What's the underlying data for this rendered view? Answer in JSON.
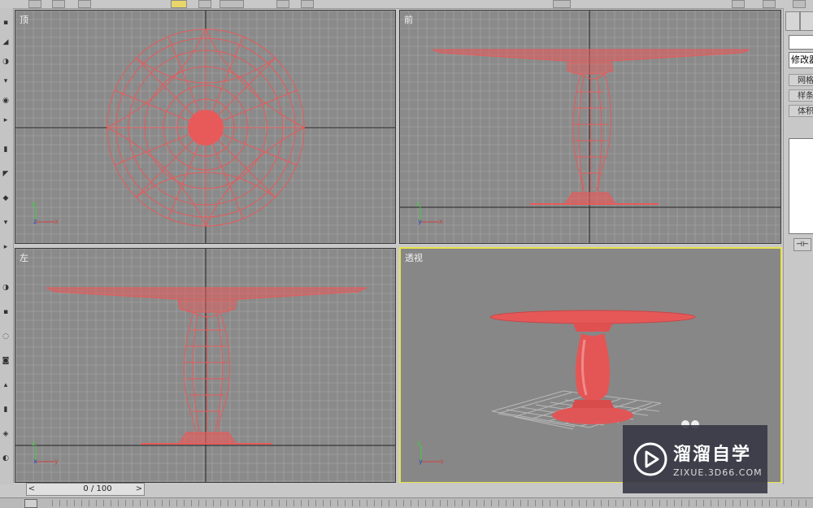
{
  "viewports": {
    "top": {
      "label": "顶"
    },
    "front": {
      "label": "前"
    },
    "left": {
      "label": "左"
    },
    "perspective": {
      "label": "透视"
    }
  },
  "command_panel": {
    "modifier_list": "修改器列表",
    "buttons": [
      "网格",
      "样条",
      "体积"
    ],
    "small_button": "⊣⊢"
  },
  "time_slider": {
    "frame_text": "0 / 100",
    "prev": "<",
    "next": ">"
  },
  "watermark": {
    "name": "溜溜自学",
    "url": "ZIXUE.3D66.COM"
  },
  "colors": {
    "viewport_bg": "#8a8a8a",
    "active_border": "#e8e24a",
    "model": "#e85a5a",
    "grid": "#a8a8a8"
  }
}
